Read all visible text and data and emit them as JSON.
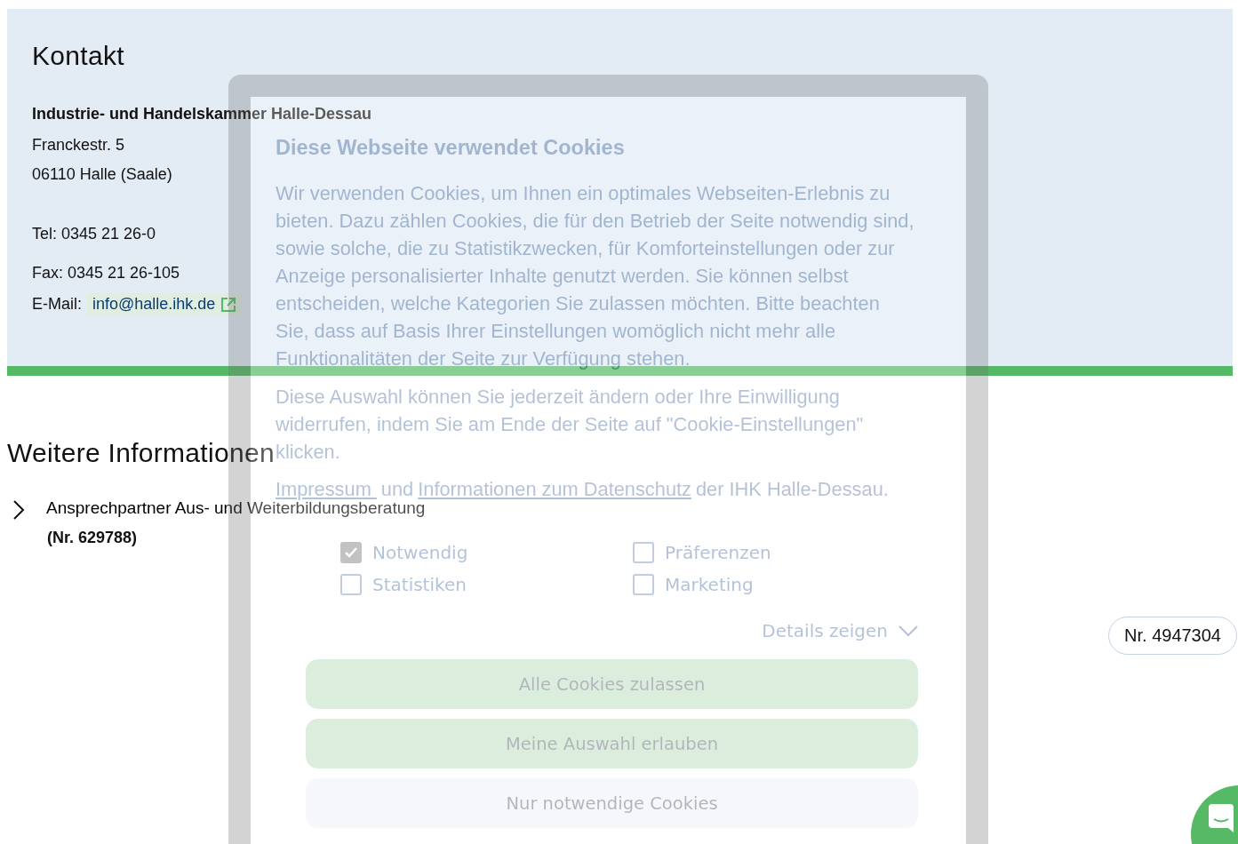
{
  "contact": {
    "heading": "Kontakt",
    "organization": "Industrie- und Handelskammer Halle-Dessau",
    "address": [
      "Franckestr. 5",
      "06110 Halle (Saale)"
    ],
    "phone": "Tel: 0345 21 26-0",
    "fax": "Fax: 0345 21 26-105",
    "email_label": "E-Mail:",
    "email": "info@halle.ihk.de"
  },
  "further_info": {
    "heading": "Weitere Informationen",
    "items": [
      {
        "title": "Ansprechpartner Aus- und Weiterbildungsberatung",
        "number": "(Nr. 629788)",
        "expanded": false
      }
    ]
  },
  "page_number": "Nr. 4947304",
  "cookie_dialog": {
    "title": "Diese Webseite verwendet Cookies",
    "paragraphs": [
      "Wir verwenden Cookies, um Ihnen ein optimales Webseiten-Erlebnis zu bieten. Dazu zählen Cookies, die für den Betrieb der Seite notwendig sind, sowie solche, die zu Statistikzwecken, für Komforteinstellungen oder zur Anzeige personalisierter Inhalte genutzt werden. Sie können selbst entscheiden, welche Kategorien Sie zulassen möchten. Bitte beachten Sie, dass auf Basis Ihrer Einstellungen womöglich nicht mehr alle Funktionalitäten der Seite zur Verfügung stehen.",
      "Diese Auswahl können Sie jederzeit ändern oder Ihre Einwilligung widerrufen, indem Sie am Ende der Seite auf \"Cookie-Einstellungen\" klicken."
    ],
    "notice": [
      {
        "kind": "link",
        "text": "Impressum "
      },
      {
        "kind": "text",
        "text": "und"
      },
      {
        "kind": "link",
        "text": "Informationen zum Datenschutz"
      },
      {
        "kind": "text",
        "text": "der IHK Halle-Dessau."
      }
    ],
    "options": [
      {
        "label": "Notwendig",
        "checked": true,
        "disabled": true
      },
      {
        "label": "Präferenzen",
        "checked": false,
        "disabled": false
      },
      {
        "label": "Statistiken",
        "checked": false,
        "disabled": false
      },
      {
        "label": "Marketing",
        "checked": false,
        "disabled": false
      }
    ],
    "details_toggle": "Details zeigen",
    "buttons": [
      {
        "label": "Alle Cookies zulassen",
        "kind": "primary"
      },
      {
        "label": "Meine Auswahl erlauben",
        "kind": "primary"
      },
      {
        "label": "Nur notwendige Cookies",
        "kind": "secondary"
      }
    ]
  }
}
